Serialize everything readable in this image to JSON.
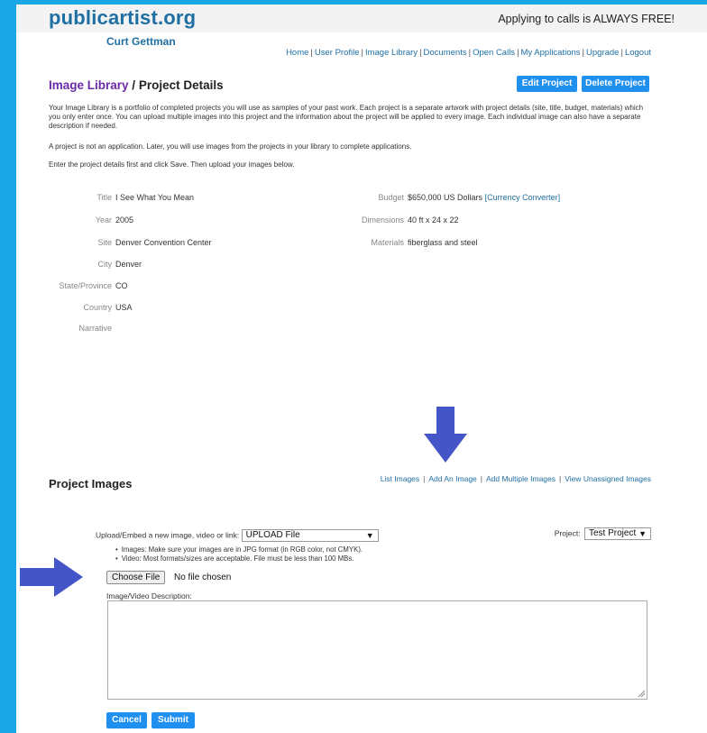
{
  "header": {
    "logo": "publicartist.org",
    "user_name": "Curt Gettman",
    "tagline": "Applying to calls is ALWAYS FREE!",
    "nav": [
      "Home",
      "User Profile",
      "Image Library",
      "Documents",
      "Open Calls",
      "My Applications",
      "Upgrade",
      "Logout"
    ]
  },
  "page": {
    "breadcrumb_link": "Image Library",
    "breadcrumb_sep": " / ",
    "title": "Project Details",
    "edit_button": "Edit Project",
    "delete_button": "Delete Project",
    "intro_1": "Your Image Library is a portfolio of completed projects you will use as samples of your past work. Each project is a separate artwork with project details (site, title, budget, materials) which you only enter once. You can upload multiple images into this project and the information about the project will be applied to every image. Each individual image can also have a separate description if needed.",
    "intro_2": "A project is not an application. Later, you will use images from the projects in your library to complete applications.",
    "intro_3": "Enter the project details first and click Save. Then upload your images below."
  },
  "project": {
    "title_label": "Title",
    "title_value": "I See What You Mean",
    "year_label": "Year",
    "year_value": "2005",
    "site_label": "Site",
    "site_value": "Denver Convention Center",
    "city_label": "City",
    "city_value": "Denver",
    "state_label": "State/Province",
    "state_value": "CO",
    "country_label": "Country",
    "country_value": "USA",
    "narrative_label": "Narrative",
    "budget_label": "Budget",
    "budget_value": "$650,000 US Dollars",
    "currency_link": "[Currency Converter]",
    "dimensions_label": "Dimensions",
    "dimensions_value": "40 ft x 24 x 22",
    "materials_label": "Materials",
    "materials_value": "fiberglass and steel"
  },
  "images_section": {
    "title": "Project Images",
    "links": [
      "List Images",
      "Add An Image",
      "Add Multiple Images",
      "View Unassigned Images"
    ],
    "upload_label": "Upload/Embed a new image, video or link:",
    "upload_select_value": "UPLOAD File",
    "project_label": "Project:",
    "project_select_value": "Test Project",
    "bullet_1": "Images: Make sure your images are in JPG format (in RGB color, not CMYK).",
    "bullet_2": "Video: Most formats/sizes are acceptable. File must be less than 100 MBs.",
    "choose_file": "Choose File",
    "no_file": "No file chosen",
    "description_label": "Image/Video Description:",
    "cancel_button": "Cancel",
    "submit_button": "Submit"
  },
  "icons": {
    "arrow_down": "arrow-down-icon",
    "arrow_right": "arrow-right-icon",
    "arrow_color": "#4455c8",
    "accent": "#1f8ff0",
    "background": "#1aa7e6"
  }
}
